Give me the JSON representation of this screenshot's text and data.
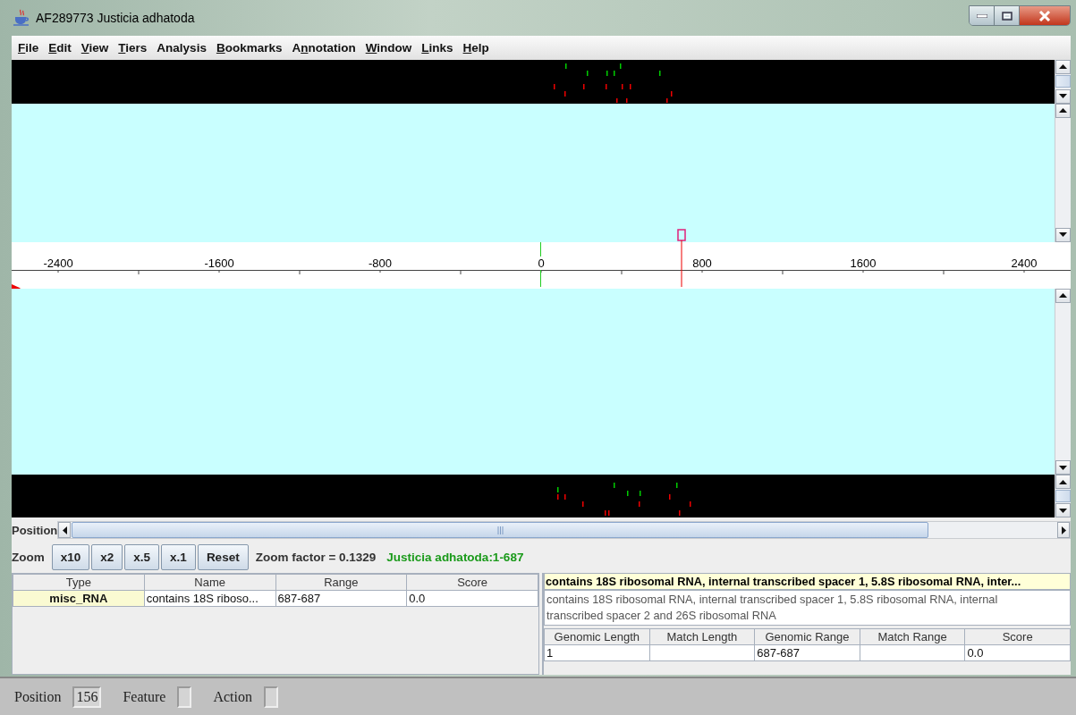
{
  "window": {
    "title": "AF289773 Justicia adhatoda"
  },
  "menu": [
    {
      "mnemonic": "F",
      "after": "ile"
    },
    {
      "mnemonic": "E",
      "after": "dit"
    },
    {
      "mnemonic": "V",
      "after": "iew"
    },
    {
      "mnemonic": "T",
      "after": "iers"
    },
    {
      "label": "Analysis"
    },
    {
      "mnemonic": "B",
      "after": "ookmarks"
    },
    {
      "before": "A",
      "mnemonic": "n",
      "after": "notation"
    },
    {
      "mnemonic": "W",
      "after": "indow"
    },
    {
      "mnemonic": "L",
      "after": "inks"
    },
    {
      "mnemonic": "H",
      "after": "elp"
    }
  ],
  "ruler": {
    "labels": [
      "-2400",
      "-1600",
      "-800",
      "0",
      "800",
      "1600",
      "2400"
    ]
  },
  "position_bar": {
    "label": "Position"
  },
  "zoom": {
    "label": "Zoom",
    "buttons": [
      "x10",
      "x2",
      "x.5",
      "x.1",
      "Reset"
    ],
    "factor": "Zoom factor = 0.1329",
    "range": "Justicia adhatoda:1-687"
  },
  "feature_table": {
    "columns": [
      "Type",
      "Name",
      "Range",
      "Score"
    ],
    "rows": [
      [
        "misc_RNA",
        "contains 18S riboso...",
        "687-687",
        "0.0"
      ]
    ]
  },
  "detail": {
    "title": "contains 18S ribosomal RNA, internal transcribed spacer 1, 5.8S ribosomal RNA, inter...",
    "description": "contains 18S ribosomal RNA, internal transcribed spacer 1, 5.8S ribosomal RNA, internal transcribed spacer 2 and 26S ribosomal RNA",
    "table": {
      "columns": [
        "Genomic Length",
        "Match Length",
        "Genomic Range",
        "Match Range",
        "Score"
      ],
      "rows": [
        [
          "1",
          null,
          "687-687",
          null,
          "0.0"
        ]
      ]
    }
  },
  "status_bar": {
    "fields": [
      {
        "label": "Position",
        "value": "156"
      },
      {
        "label": "Feature"
      },
      {
        "label": "Action"
      }
    ]
  }
}
